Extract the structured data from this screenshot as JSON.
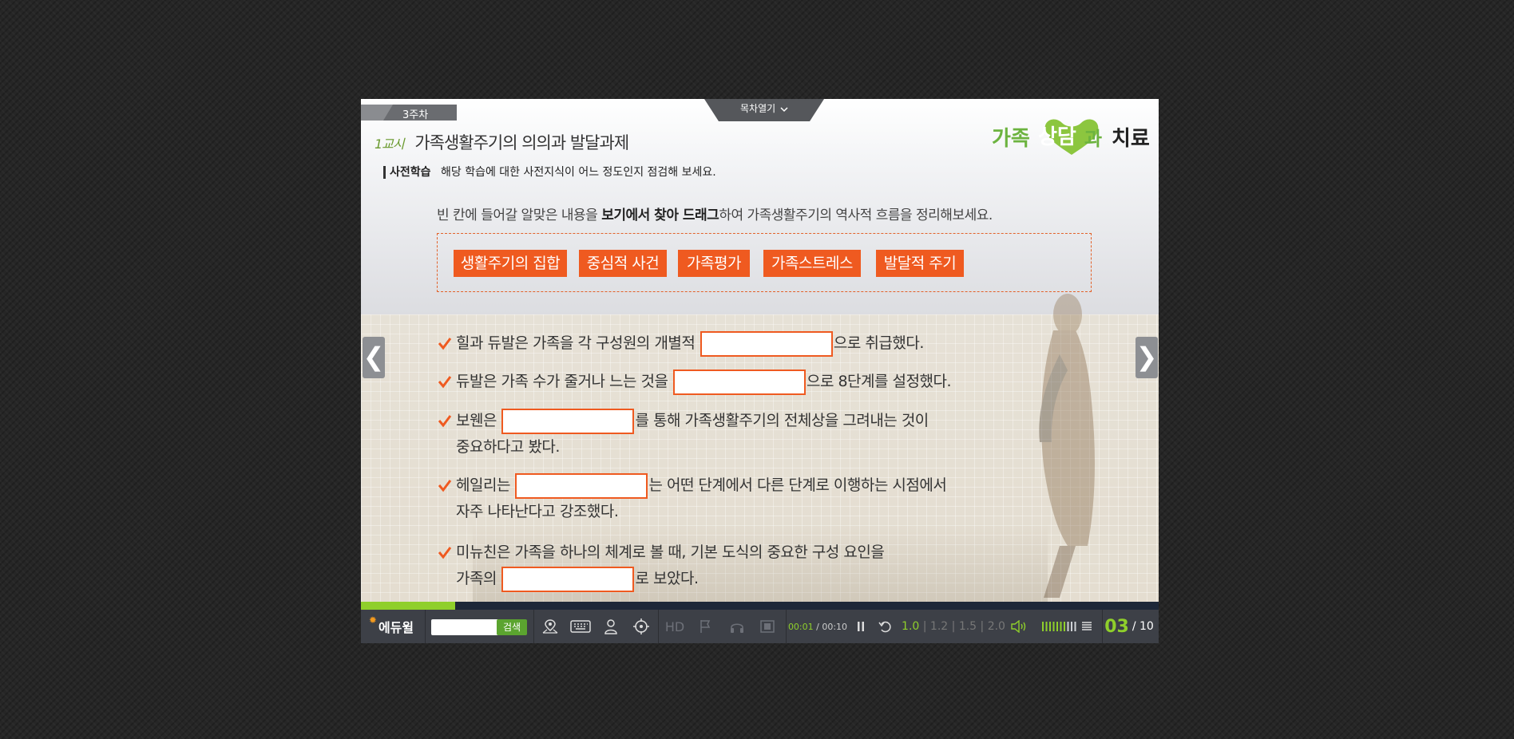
{
  "header": {
    "week_label": "3주차",
    "toc_label": "목차열기",
    "lesson_number": "1교시",
    "lesson_title": "가족생활주기의 의의과 발달과제",
    "pre_study_label": "사전학습",
    "pre_study_text": "해당 학습에 대한 사전지식이 어느 정도인지 점검해 보세요."
  },
  "logo": {
    "part1": "가족",
    "part2": "상담",
    "part3": "과",
    "part4": "치료"
  },
  "instruction": {
    "before": "빈 칸에 들어갈 알맞은 내용을 ",
    "bold": "보기에서 찾아 드래그",
    "after": "하여 가족생활주기의 역사적 흐름을 정리해보세요."
  },
  "options": [
    "생활주기의 집합",
    "중심적 사건",
    "가족평가",
    "가족스트레스",
    "발달적 주기"
  ],
  "questions": [
    {
      "before": "힐과 듀발은 가족을 각 구성원의 개별적 ",
      "after": "으로 취급했다."
    },
    {
      "before": "듀발은 가족 수가 줄거나 느는 것을 ",
      "after": "으로 8단계를 설정했다."
    },
    {
      "before": "보웬은 ",
      "after": "를 통해 가족생활주기의 전체상을 그려내는 것이",
      "line2": "중요하다고 봤다."
    },
    {
      "before": "헤일리는 ",
      "after": "는 어떤 단계에서 다른 단계로 이행하는 시점에서",
      "line2": "자주 나타난다고 강조했다."
    },
    {
      "line1": "미뉴친은 가족을 하나의 체계로 볼 때, 기본 도식의 중요한 구성 요인을",
      "before2": "가족의 ",
      "after2": "로 보았다."
    }
  ],
  "nav": {
    "prev": "❮",
    "next": "❯"
  },
  "player": {
    "progress": 0.118,
    "brand": "에듀윌",
    "search_button": "검색",
    "search_placeholder": "",
    "hd_label": "HD",
    "time_current": "00:01",
    "time_total": "/ 00:10",
    "speed_options": [
      "1.0",
      "1.2",
      "1.5",
      "2.0"
    ],
    "speed_selected": "1.0",
    "speed_separator": "|",
    "volume_level": 0.7,
    "page_current": "03",
    "page_total": "/ 10"
  },
  "colors": {
    "accent": "#ef5a20",
    "green": "#8fcf2b",
    "control_bar": "#3d4047"
  }
}
